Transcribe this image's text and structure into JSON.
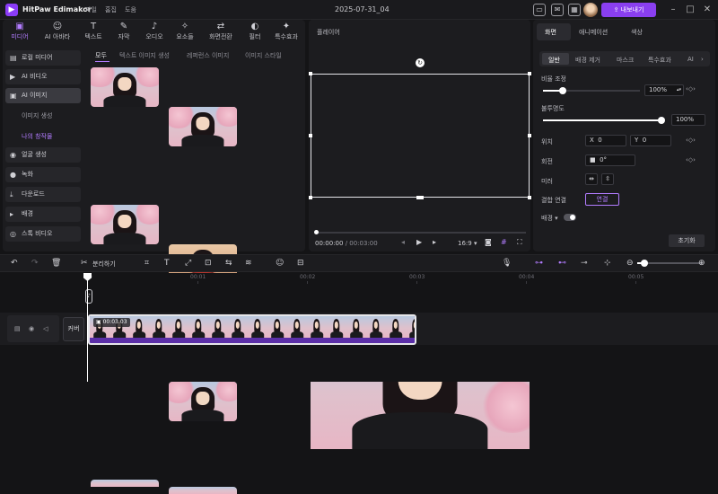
{
  "app": {
    "name": "HitPaw Edimakor",
    "menu": [
      "파일",
      "홈집",
      "도움"
    ],
    "doc_title": "2025-07-31_04",
    "export_label": "내보내기"
  },
  "tools": [
    {
      "label": "미디어",
      "icon": "▣"
    },
    {
      "label": "AI 아바타",
      "icon": "☺"
    },
    {
      "label": "텍스트",
      "icon": "T"
    },
    {
      "label": "자막",
      "icon": "✎"
    },
    {
      "label": "오디오",
      "icon": "♪"
    },
    {
      "label": "요소들",
      "icon": "✧"
    },
    {
      "label": "화면전환",
      "icon": "⇄"
    },
    {
      "label": "필터",
      "icon": "◐"
    },
    {
      "label": "특수효과",
      "icon": "✦"
    }
  ],
  "sidebar": {
    "items": [
      {
        "label": "로컬 미디어",
        "icon": "▤"
      },
      {
        "label": "AI 비디오",
        "icon": "▶"
      },
      {
        "label": "AI 이미지",
        "icon": "▣"
      },
      {
        "label": "얼굴 생성",
        "icon": "◉"
      },
      {
        "label": "녹화",
        "icon": "●"
      },
      {
        "label": "다운로드",
        "icon": "⤓"
      },
      {
        "label": "배경",
        "icon": "▸"
      },
      {
        "label": "스톡 비디오",
        "icon": "◎"
      }
    ],
    "subitems": [
      "이미지 생성",
      "나의 창작물"
    ]
  },
  "content_tabs": [
    "모두",
    "텍스트 이미지 생성",
    "레퍼런스 이미지",
    "이미지 스타일"
  ],
  "player": {
    "title": "플레이어",
    "current_time": "00:00:00",
    "total_time": "/ 00:03:00",
    "aspect": "16:9"
  },
  "right_tabs": [
    "화면",
    "애니메이션",
    "색상"
  ],
  "sub_tabs": [
    "일반",
    "배경 제거",
    "마스크",
    "특수효과",
    "AI"
  ],
  "properties": {
    "scale_label": "비율 조정",
    "scale_value": "100%",
    "scale_fraction": 0.2,
    "opacity_label": "불투명도",
    "opacity_value": "100%",
    "opacity_fraction": 1.0,
    "position_label": "위치",
    "pos_x_label": "X",
    "pos_x": "0",
    "pos_y_label": "Y",
    "pos_y": "0",
    "rotate_label": "회전",
    "rotate_value": "0°",
    "flip_label": "미러",
    "link_label": "결합 연결",
    "link_button": "연결",
    "bg_label": "배경",
    "reset_label": "초기화"
  },
  "toolbar": {
    "split_label": "분리하기"
  },
  "timeline": {
    "ruler": [
      "00",
      "00:01",
      "00:02",
      "00:03",
      "00:04",
      "00:05"
    ],
    "track_cover_label": "커버",
    "clip_label": "00:03:03"
  }
}
